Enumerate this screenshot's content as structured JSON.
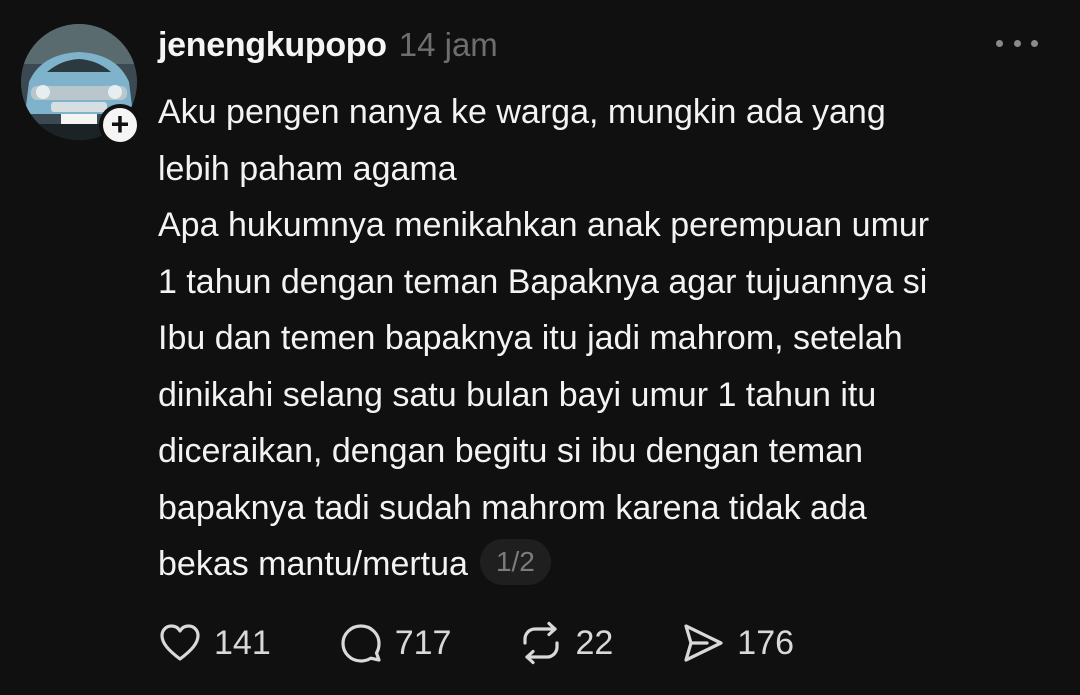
{
  "post": {
    "username": "jenengkupopo",
    "time": "14 jam",
    "avatar_icon": "classic-car-avatar",
    "follow_icon": "plus-icon",
    "lines": [
      "Aku pengen nanya ke warga, mungkin ada yang",
      "lebih paham agama",
      "Apa hukumnya menikahkan anak perempuan umur",
      "1 tahun dengan teman Bapaknya agar tujuannya si",
      "Ibu dan temen bapaknya itu jadi mahrom, setelah",
      "dinikahi selang satu bulan bayi umur 1 tahun itu",
      "diceraikan, dengan begitu si ibu dengan teman",
      "bapaknya tadi sudah mahrom karena tidak ada",
      "bekas mantu/mertua"
    ],
    "page_indicator": "1/2"
  },
  "actions": {
    "likes": "141",
    "comments": "717",
    "reposts": "22",
    "shares": "176"
  },
  "colors": {
    "background": "#101010",
    "text": "#f3f3f3",
    "muted": "#6e6e6e"
  }
}
